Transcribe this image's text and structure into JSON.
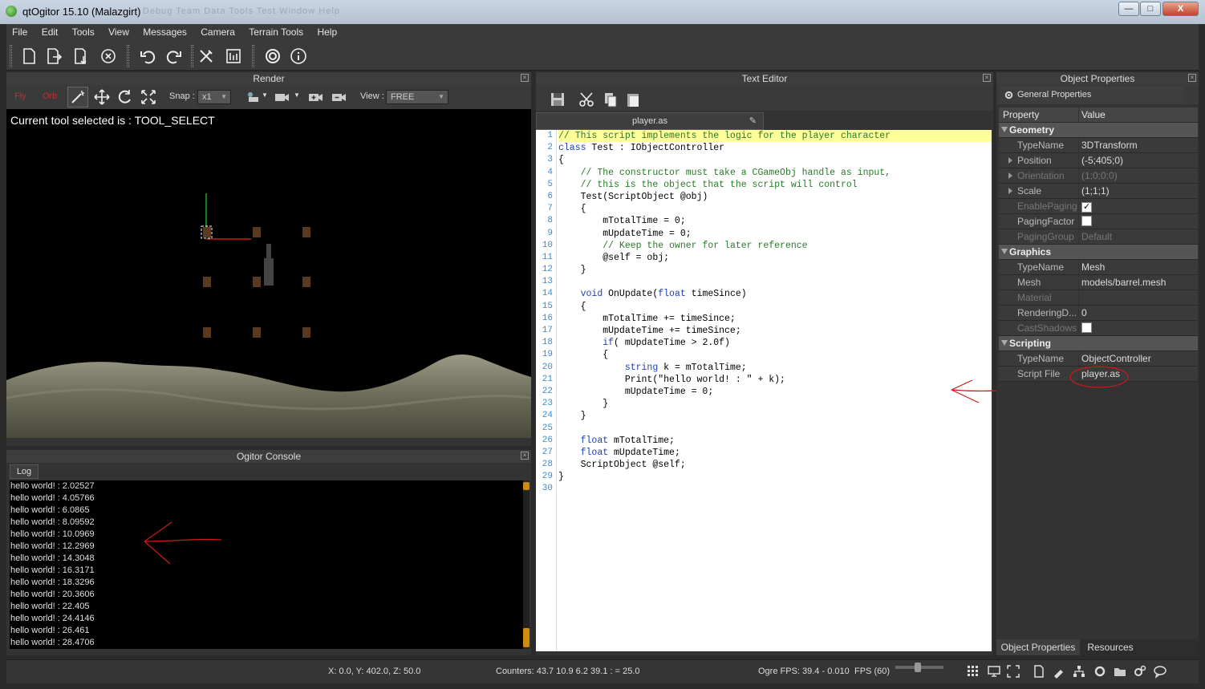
{
  "window": {
    "title": "qtOgitor 15.10 (Malazgirt)",
    "ghost_menu": "Debug  Team  Data  Tools  Test  Window  Help",
    "min": "—",
    "max": "□",
    "close": "X"
  },
  "menu": [
    "File",
    "Edit",
    "Tools",
    "View",
    "Messages",
    "Camera",
    "Terrain Tools",
    "Help"
  ],
  "toolbar_icons": [
    "new-file-icon",
    "export-icon",
    "import-icon",
    "close-scene-icon",
    "undo-icon",
    "redo-icon",
    "tools-icon",
    "terrain-icon",
    "help-icon",
    "info-icon"
  ],
  "render": {
    "title": "Render",
    "fly": "Fly",
    "orbit": "Orb",
    "snap_label": "Snap :",
    "snap_value": "x1",
    "view_label": "View :",
    "view_value": "FREE",
    "tool_label": "Current tool selected is : TOOL_SELECT"
  },
  "console": {
    "title": "Ogitor Console",
    "tab": "Log",
    "lines": [
      "hello world! : 2.02527",
      "hello world! : 4.05766",
      "hello world! : 6.0865",
      "hello world! : 8.09592",
      "hello world! : 10.0969",
      "hello world! : 12.2969",
      "hello world! : 14.3048",
      "hello world! : 16.3171",
      "hello world! : 18.3296",
      "hello world! : 20.3606",
      "hello world! : 22.405",
      "hello world! : 24.4146",
      "hello world! : 26.461",
      "hello world! : 28.4706"
    ]
  },
  "editor": {
    "title": "Text Editor",
    "tab": "player.as",
    "lines": [
      "// This script implements the logic for the player character",
      "class Test : IObjectController",
      "{",
      "    // The constructor must take a CGameObj handle as input,",
      "    // this is the object that the script will control",
      "    Test(ScriptObject @obj)",
      "    {",
      "        mTotalTime = 0;",
      "        mUpdateTime = 0;",
      "        // Keep the owner for later reference",
      "        @self = obj;",
      "    }",
      "",
      "    void OnUpdate(float timeSince)",
      "    {",
      "        mTotalTime += timeSince;",
      "        mUpdateTime += timeSince;",
      "        if( mUpdateTime > 2.0f)",
      "        {",
      "            string k = mTotalTime;",
      "            Print(\"hello world! : \" + k);",
      "            mUpdateTime = 0;",
      "        }",
      "    }",
      "",
      "    float mTotalTime;",
      "    float mUpdateTime;",
      "    ScriptObject @self;",
      "}",
      ""
    ]
  },
  "properties": {
    "title": "Object Properties",
    "tab": "General Properties",
    "col_property": "Property",
    "col_value": "Value",
    "rows": [
      {
        "type": "group",
        "label": "Geometry"
      },
      {
        "key": "TypeName",
        "value": "3DTransform"
      },
      {
        "key": "Position",
        "value": "(-5;405;0)",
        "expand": true
      },
      {
        "key": "Orientation",
        "value": "(1;0;0;0)",
        "expand": true,
        "disabled": true
      },
      {
        "key": "Scale",
        "value": "(1;1;1)",
        "expand": true
      },
      {
        "key": "EnablePaging",
        "check": "✓",
        "disabled": true
      },
      {
        "key": "PagingFactor",
        "check": ""
      },
      {
        "key": "PagingGroup",
        "value": "Default",
        "disabled": true
      },
      {
        "type": "group",
        "label": "Graphics"
      },
      {
        "key": "TypeName",
        "value": "Mesh"
      },
      {
        "key": "Mesh",
        "value": "models/barrel.mesh"
      },
      {
        "key": "Material",
        "value": "",
        "disabled": true
      },
      {
        "key": "RenderingD...",
        "value": "0"
      },
      {
        "key": "CastShadows",
        "check": "",
        "disabled": true
      },
      {
        "type": "group",
        "label": "Scripting"
      },
      {
        "key": "TypeName",
        "value": "ObjectController"
      },
      {
        "key": "Script File",
        "value": "player.as"
      }
    ],
    "bottom_tabs": [
      "Object Properties",
      "Resources"
    ]
  },
  "status": {
    "coords": "X: 0.0, Y: 402.0, Z: 50.0",
    "counters": "Counters: 43.7 10.9 6.2 39.1 : = 25.0",
    "fps": "Ogre FPS: 39.4 - 0.010",
    "fps_limit": "FPS (60)"
  },
  "colors": {
    "accent": "#d18a10",
    "annotation": "#d01818",
    "highlight": "#ffff9a"
  }
}
